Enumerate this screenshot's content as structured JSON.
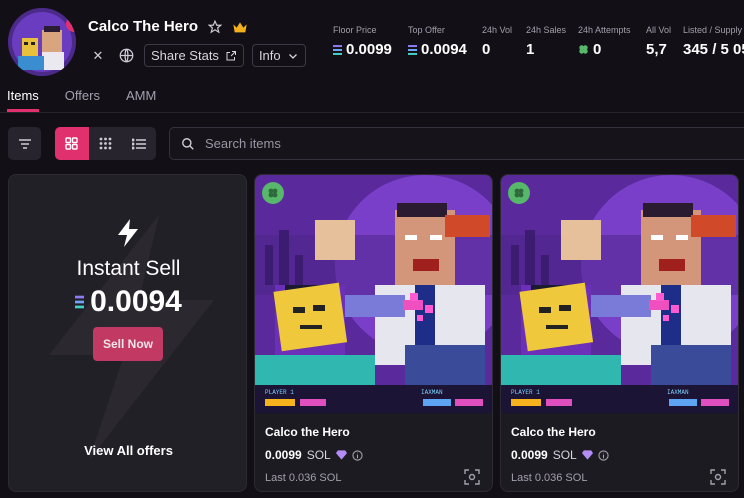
{
  "collection": {
    "title": "Calco The Hero",
    "share_label": "Share Stats",
    "info_label": "Info"
  },
  "stats": [
    {
      "label": "Floor Price",
      "value": "0.0099",
      "sol": true
    },
    {
      "label": "Top Offer",
      "value": "0.0094",
      "sol": true
    },
    {
      "label": "24h Vol",
      "value": "0"
    },
    {
      "label": "24h Sales",
      "value": "1"
    },
    {
      "label": "24h Attempts",
      "value": "0"
    },
    {
      "label": "All Vol",
      "value": "5,7"
    },
    {
      "label": "Listed / Supply",
      "value": "345 / 5 05"
    }
  ],
  "tabs": [
    {
      "label": "Items",
      "active": true
    },
    {
      "label": "Offers"
    },
    {
      "label": "AMM"
    }
  ],
  "search": {
    "placeholder": "Search items"
  },
  "instant_sell": {
    "title": "Instant Sell",
    "price": "0.0094",
    "button": "Sell Now",
    "view_all": "View All offers"
  },
  "items": [
    {
      "name": "Calco the Hero",
      "price": "0.0099",
      "unit": "SOL",
      "last": "Last 0.036 SOL",
      "hud_left": "PLAYER 1",
      "hud_right": "IAXMAN"
    },
    {
      "name": "Calco the Hero",
      "price": "0.0099",
      "unit": "SOL",
      "last": "Last 0.036 SOL",
      "hud_left": "PLAYER 1",
      "hud_right": "IAXMAN"
    }
  ],
  "colors": {
    "accent": "#e0306e",
    "background": "#121016",
    "card": "#222027",
    "rarity_badge": "#57b76a"
  }
}
